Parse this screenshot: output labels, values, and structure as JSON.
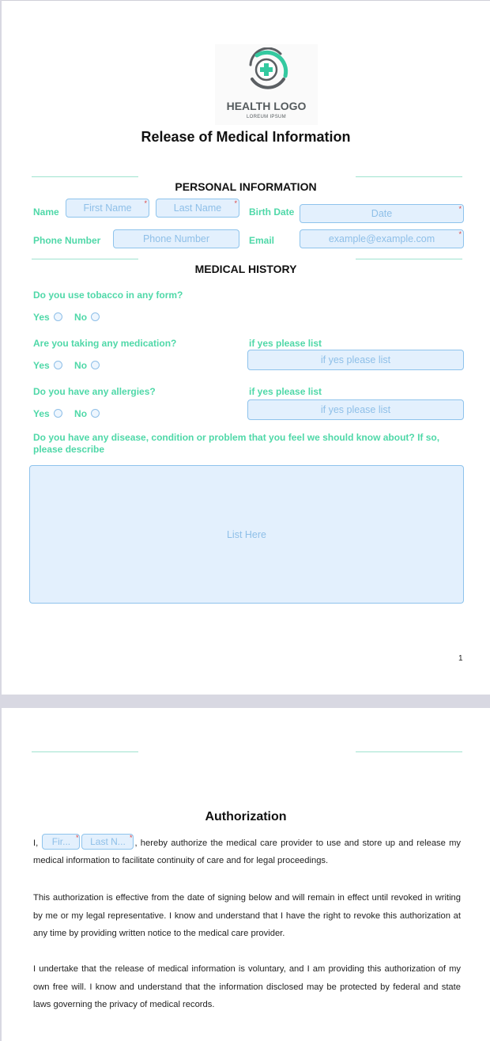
{
  "logo": {
    "title": "HEALTH LOGO",
    "subtitle": "LOREUM IPSUM",
    "colors": {
      "accent": "#34c9a0",
      "gray": "#5b5f63"
    }
  },
  "document": {
    "title": "Release of Medical Information",
    "page_number": "1"
  },
  "personal_information": {
    "heading": "PERSONAL INFORMATION",
    "name_label": "Name",
    "first_name_placeholder": "First Name",
    "last_name_placeholder": "Last Name",
    "birth_date_label": "Birth Date",
    "birth_date_placeholder": "Date",
    "phone_label": "Phone Number",
    "phone_placeholder": "Phone Number",
    "email_label": "Email",
    "email_placeholder": "example@example.com",
    "required_marker": "*"
  },
  "medical_history": {
    "heading": "MEDICAL HISTORY",
    "tobacco_question": "Do you use tobacco in any form?",
    "medication_question": "Are you taking any medication?",
    "allergies_question": "Do you have any allergies?",
    "if_yes_label": "if yes please list",
    "if_yes_placeholder": "if yes please list",
    "yes_label": "Yes",
    "no_label": "No",
    "disease_question": "Do you have any disease, condition or problem that you feel we should know about? If so, please describe",
    "disease_placeholder": "List Here"
  },
  "authorization": {
    "heading": "Authorization",
    "prefix": "I,",
    "first_name_placeholder": "Fir...",
    "last_name_placeholder": "Last N...",
    "paragraph1_rest": ", hereby authorize the medical care provider to use and store up and release my medical information to facilitate continuity of care and for legal proceedings.",
    "paragraph2": "This authorization is effective from the date of signing below and will remain in effect until revoked in writing by me or my legal representative. I know and understand that I have the right to revoke this authorization at any time by providing written notice to the medical care provider.",
    "paragraph3": "I undertake that the release of medical information is voluntary, and I am providing this authorization of my own free will. I know and understand that the information disclosed may be protected by federal and state laws governing the privacy of medical records."
  },
  "colors": {
    "label_green": "#4fd8a8",
    "field_bg": "#e3f0fd",
    "field_border": "#8ec3ec",
    "placeholder": "#8ebfe8",
    "required": "#dd4444",
    "rule": "#9fe3cf"
  }
}
